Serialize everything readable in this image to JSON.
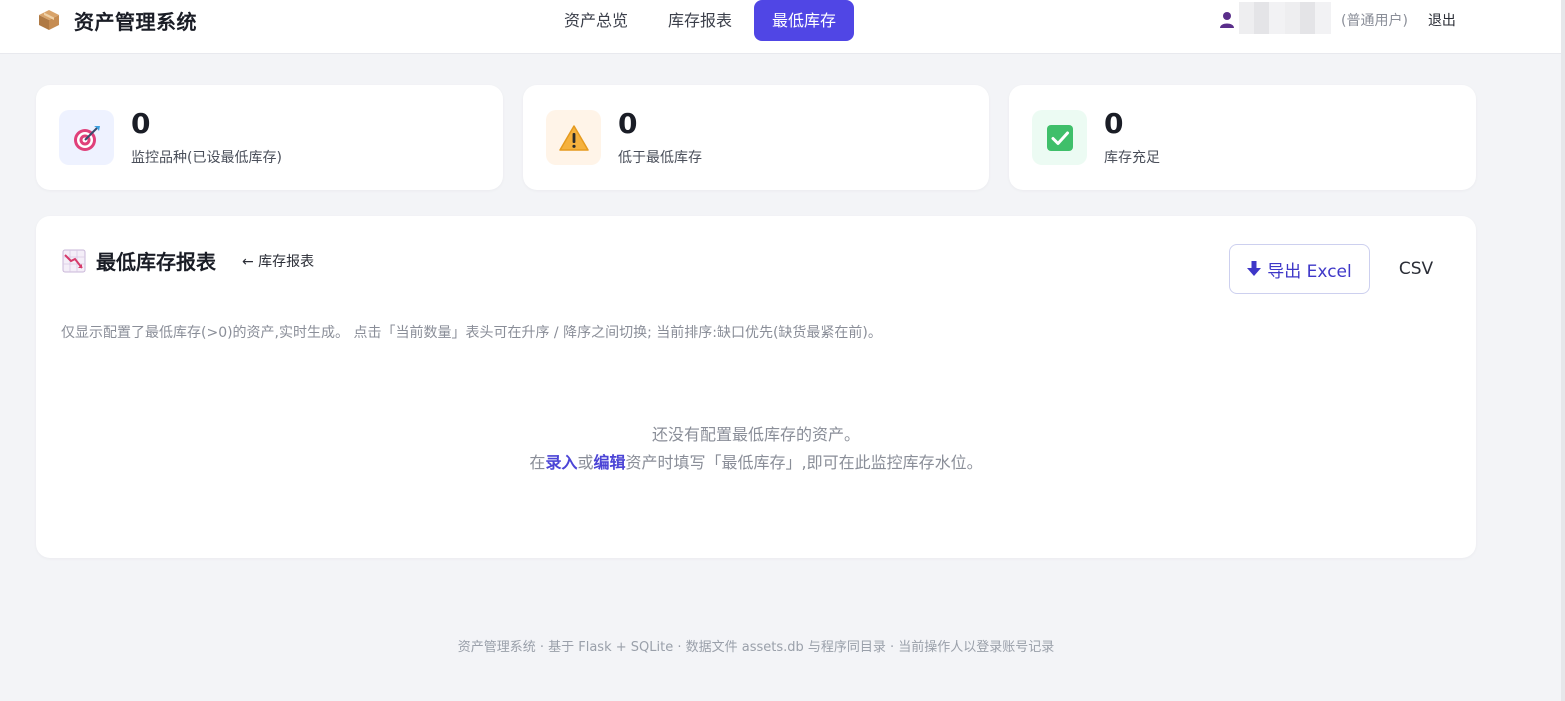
{
  "header": {
    "brand_title": "资产管理系统",
    "brand_icon": "package-box-icon",
    "nav": [
      {
        "label": "资产总览",
        "active": false
      },
      {
        "label": "库存报表",
        "active": false
      },
      {
        "label": "最低库存",
        "active": true
      }
    ],
    "user": {
      "role": "(普通用户)",
      "logout_label": "退出"
    }
  },
  "stats": [
    {
      "value": "0",
      "label": "监控品种(已设最低库存)",
      "icon": "target-icon",
      "bg": "#eef2ff"
    },
    {
      "value": "0",
      "label": "低于最低库存",
      "icon": "warning-icon",
      "bg": "#fff4e8"
    },
    {
      "value": "0",
      "label": "库存充足",
      "icon": "checkmark-icon",
      "bg": "#ecfbf3"
    }
  ],
  "report": {
    "title": "最低库存报表",
    "back_link": "← 库存报表",
    "export_excel_label": "导出 Excel",
    "export_csv_label": "CSV",
    "description": "仅显示配置了最低库存(>0)的资产,实时生成。 点击「当前数量」表头可在升序 / 降序之间切换; 当前排序:缺口优先(缺货最紧在前)。",
    "empty": {
      "line1": "还没有配置最低库存的资产。",
      "prefix": "在",
      "link_add": "录入",
      "or": "或",
      "link_edit": "编辑",
      "suffix": "资产时填写「最低库存」,即可在此监控库存水位。"
    }
  },
  "footer": "资产管理系统 · 基于 Flask + SQLite · 数据文件 assets.db 与程序同目录 · 当前操作人以登录账号记录",
  "colors": {
    "accent": "#5046e5",
    "background": "#f3f4f7"
  }
}
